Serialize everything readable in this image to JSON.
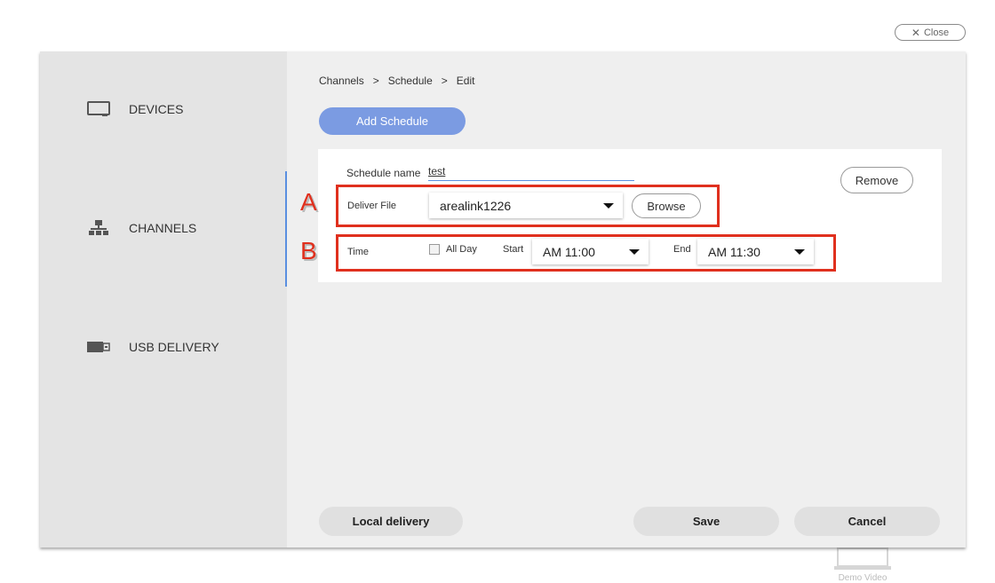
{
  "close": {
    "label": "Close"
  },
  "sidebar": {
    "items": [
      {
        "label": "DEVICES",
        "icon": "monitor-icon"
      },
      {
        "label": "CHANNELS",
        "icon": "network-icon"
      },
      {
        "label": "USB DELIVERY",
        "icon": "usb-drive-icon"
      }
    ],
    "active": "CHANNELS"
  },
  "breadcrumb": [
    "Channels",
    ">",
    "Schedule",
    ">",
    "Edit"
  ],
  "add_schedule_label": "Add Schedule",
  "schedule": {
    "name_label": "Schedule name",
    "name_value": "test",
    "remove_label": "Remove",
    "deliver_file_label": "Deliver File",
    "deliver_file_value": "arealink1226",
    "browse_label": "Browse",
    "time_label": "Time",
    "all_day_label": "All Day",
    "start_label": "Start",
    "start_value": "AM 11:00",
    "end_label": "End",
    "end_value": "AM 11:30"
  },
  "markers": {
    "a": "A",
    "b": "B"
  },
  "footer": {
    "local_delivery_label": "Local delivery",
    "save_label": "Save",
    "cancel_label": "Cancel"
  },
  "background_text": {
    "demo_video": "Demo Video"
  },
  "colors": {
    "accent": "#7b9be2",
    "highlight": "#e0301e",
    "active_bar": "#5a8fe0"
  }
}
